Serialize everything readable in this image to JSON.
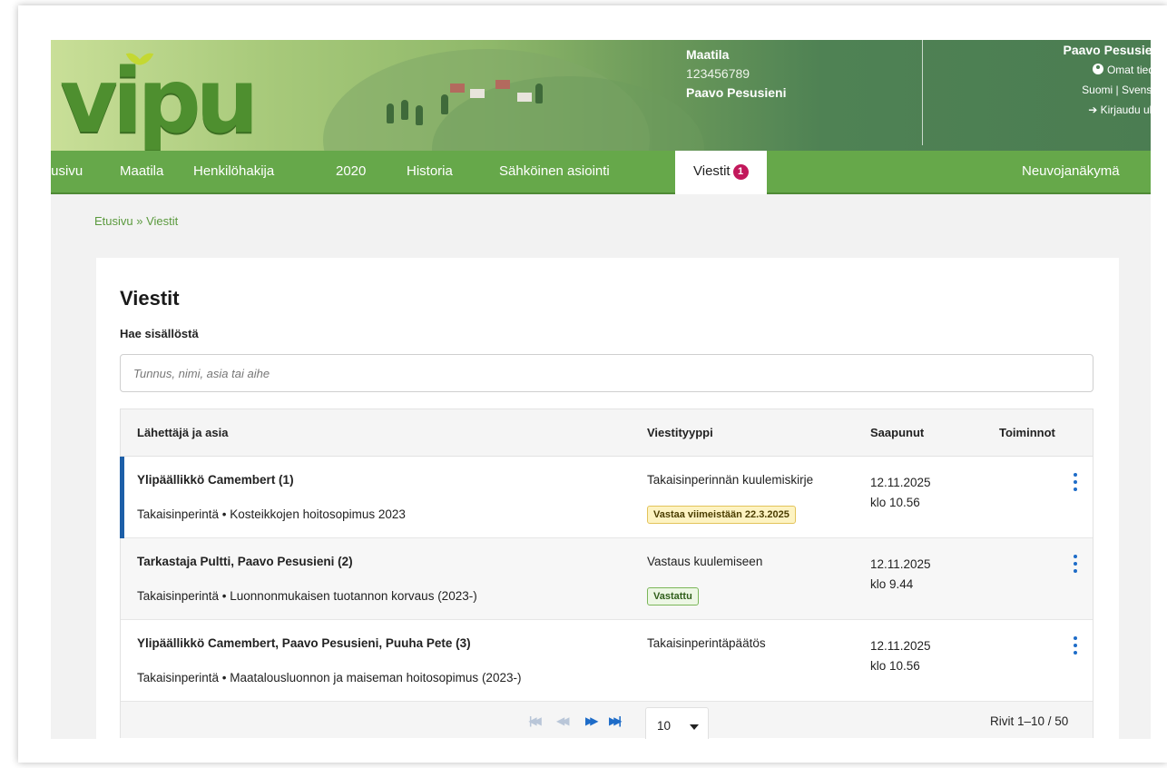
{
  "header": {
    "logo_text": "vipu",
    "farm_label": "Maatila",
    "farm_id": "123456789",
    "farm_owner": "Paavo Pesusieni",
    "user_name": "Paavo Pesusieni",
    "own_info": "Omat tiedot",
    "languages": "Suomi | Svenska",
    "logout": "Kirjaudu ulos"
  },
  "nav": {
    "items": [
      "Etusivu",
      "Maatila",
      "Henkilöhakija",
      "2020",
      "Historia",
      "Sähköinen asiointi"
    ],
    "active": "Viestit",
    "active_badge": "1",
    "right": "Neuvojanäkymä"
  },
  "breadcrumb": "Etusivu » Viestit",
  "page": {
    "title": "Viestit",
    "search_label": "Hae sisällöstä",
    "search_placeholder": "Tunnus, nimi, asia tai aihe"
  },
  "table": {
    "headers": [
      "Lähettäjä ja asia",
      "Viestityyppi",
      "Saapunut",
      "Toiminnot"
    ],
    "rows": [
      {
        "sender": "Ylipäällikkö Camembert  (1)",
        "subject": "Takaisinperintä • Kosteikkojen hoitosopimus 2023",
        "type": "Takaisinperinnän kuulemiskirje",
        "tag": "Vastaa viimeistään 22.3.2025",
        "date": "12.11.2025",
        "time": "klo 10.56"
      },
      {
        "sender": "Tarkastaja Pultti, Paavo Pesusieni  (2)",
        "subject": "Takaisinperintä • Luonnonmukaisen tuotannon korvaus (2023-)",
        "type": "Vastaus kuulemiseen",
        "tag": "Vastattu",
        "date": "12.11.2025",
        "time": "klo 9.44"
      },
      {
        "sender": "Ylipäällikkö Camembert, Paavo Pesusieni, Puuha Pete  (3)",
        "subject": "Takaisinperintä • Maatalousluonnon ja maiseman hoitosopimus (2023-)",
        "type": "Takaisinperintäpäätös",
        "tag": "",
        "date": "12.11.2025",
        "time": "klo 10.56"
      }
    ],
    "page_size": "10",
    "rows_info": "Rivit 1–10 / 50"
  },
  "colors": {
    "nav_green": "#66a84a",
    "unread_marker": "#1d5fa8",
    "badge": "#c2185b",
    "action_blue": "#1e6cc8"
  }
}
